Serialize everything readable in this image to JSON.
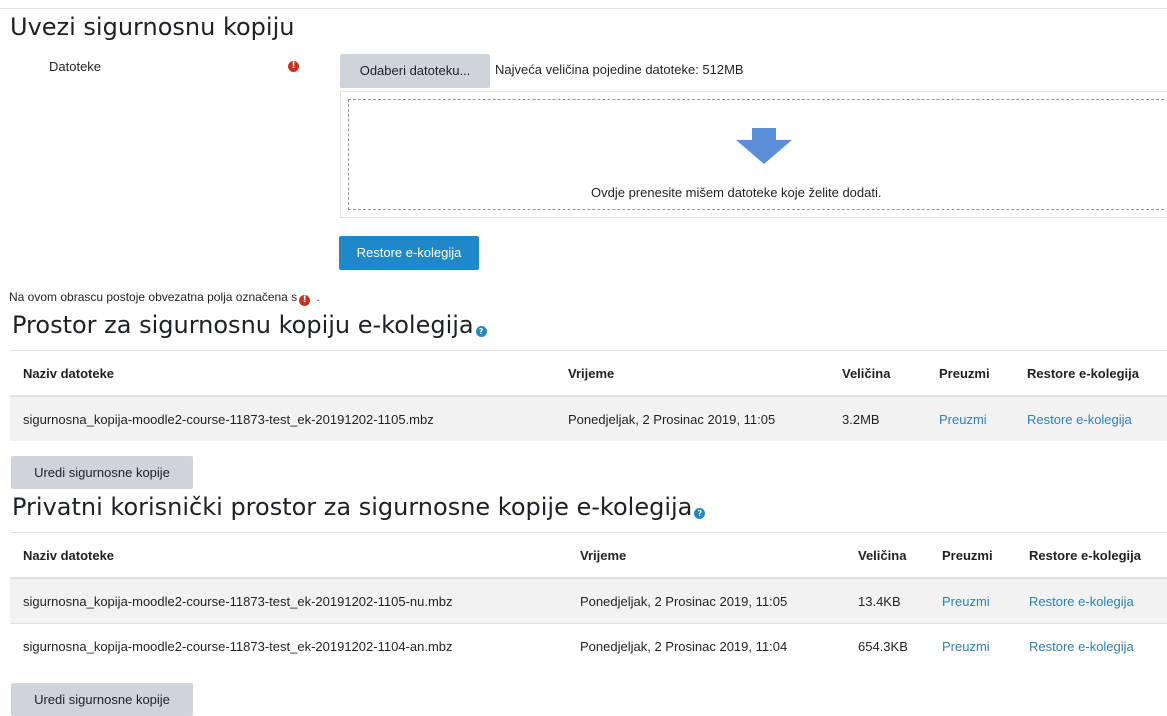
{
  "page": {
    "title": "Uvezi sigurnosnu kopiju"
  },
  "form": {
    "files_label": "Datoteke",
    "choose_button": "Odaberi datoteku...",
    "max_size": "Najveća veličina pojedine datoteke: 512MB",
    "dropzone_text": "Ovdje prenesite mišem datoteke koje želite dodati.",
    "restore_button": "Restore e-kolegija",
    "required_note": "Na ovom obrascu postoje obvezatna polja označena s",
    "required_note_end": ".",
    "required_icon": "!"
  },
  "course_area": {
    "title": "Prostor za sigurnosnu kopiju e-kolegija",
    "help_icon": "?",
    "columns": [
      "Naziv datoteke",
      "Vrijeme",
      "Veličina",
      "Preuzmi",
      "Restore e-kolegija"
    ],
    "rows": [
      {
        "name": "sigurnosna_kopija-moodle2-course-11873-test_ek-20191202-1105.mbz",
        "time": "Ponedjeljak, 2 Prosinac 2019, 11:05",
        "size": "3.2MB",
        "download": "Preuzmi",
        "restore": "Restore e-kolegija"
      }
    ],
    "manage_button": "Uredi sigurnosne kopije"
  },
  "user_area": {
    "title": "Privatni korisnički prostor za sigurnosne kopije e-kolegija",
    "help_icon": "?",
    "columns": [
      "Naziv datoteke",
      "Vrijeme",
      "Veličina",
      "Preuzmi",
      "Restore e-kolegija"
    ],
    "rows": [
      {
        "name": "sigurnosna_kopija-moodle2-course-11873-test_ek-20191202-1105-nu.mbz",
        "time": "Ponedjeljak, 2 Prosinac 2019, 11:05",
        "size": "13.4KB",
        "download": "Preuzmi",
        "restore": "Restore e-kolegija"
      },
      {
        "name": "sigurnosna_kopija-moodle2-course-11873-test_ek-20191202-1104-an.mbz",
        "time": "Ponedjeljak, 2 Prosinac 2019, 11:04",
        "size": "654.3KB",
        "download": "Preuzmi",
        "restore": "Restore e-kolegija"
      }
    ],
    "manage_button": "Uredi sigurnosne kopije"
  },
  "colors": {
    "primary": "#1e88c8",
    "required": "#ca3120",
    "arrow": "#5b8ed6"
  }
}
